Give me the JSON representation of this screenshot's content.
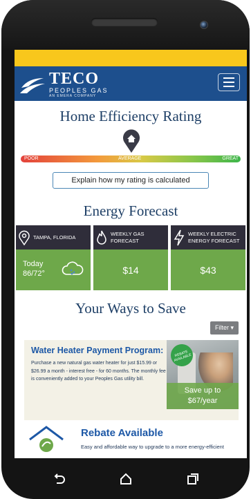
{
  "header": {
    "brand_name": "TECO",
    "brand_sub": "PEOPLES GAS",
    "brand_small": "AN EMERA COMPANY",
    "menu_icon": "hamburger-menu-icon"
  },
  "rating": {
    "title": "Home Efficiency Rating",
    "scale_labels": {
      "poor": "POOR",
      "average": "AVERAGE",
      "great": "GREAT"
    },
    "marker_icon": "home-pin-icon",
    "marker_level": 0.5,
    "explain_button": "Explain how my rating is calculated"
  },
  "forecast": {
    "title": "Energy Forecast",
    "cards": [
      {
        "icon": "location-pin-icon",
        "label": "TAMPA, FLORIDA",
        "line1": "Today",
        "line2": "86/72°",
        "weather_icon": "rain-cloud-icon"
      },
      {
        "icon": "flame-icon",
        "label": "WEEKLY GAS FORECAST",
        "value": "$14"
      },
      {
        "icon": "lightning-bolt-icon",
        "label": "WEEKLY ELECTRIC ENERGY FORECAST",
        "value": "$43"
      }
    ]
  },
  "save": {
    "title": "Your Ways to Save",
    "filter_label": "Filter"
  },
  "program": {
    "title": "Water Heater Payment Program:",
    "description": "Purchase a new natural gas water heater for just $15.99 or $26.99 a month - interest free - for 60 months. The monthly fee is conveniently added to your Peoples Gas utility bill.",
    "badge": "REBATE AVAILABLE",
    "overlay_line1": "Save up to",
    "overlay_line2": "$67/year"
  },
  "rebate": {
    "title": "Rebate Available",
    "description": "Easy and affordable way to upgrade to a more energy-efficient"
  },
  "colors": {
    "header_blue": "#1d4f8d",
    "status_yellow": "#f8c71c",
    "card_green": "#6ea84a",
    "card_dark": "#2f2d3a",
    "title_navy": "#1e3f66"
  },
  "navbar": {
    "back_icon": "back-icon",
    "home_icon": "home-icon",
    "recents_icon": "recents-icon"
  }
}
